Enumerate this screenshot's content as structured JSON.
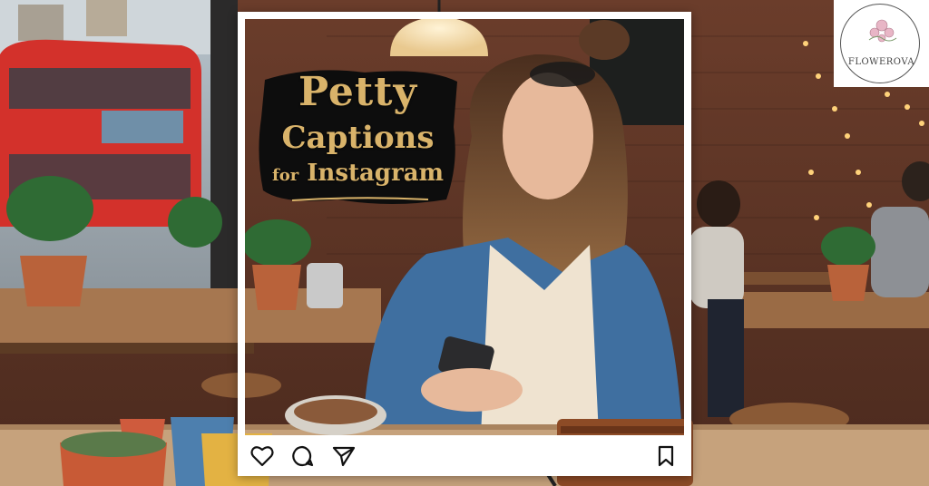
{
  "headline": {
    "line1": "Petty",
    "line2": "Captions",
    "line3_for": "for",
    "line3_rest": "Instagram"
  },
  "logo": {
    "text": "FLOWEROVA"
  },
  "post_actions": {
    "like_icon": "heart-icon",
    "comment_icon": "comment-icon",
    "share_icon": "send-icon",
    "save_icon": "bookmark-icon"
  },
  "colors": {
    "title_gold": "#d9b36a",
    "frame": "#ffffff",
    "bus_red": "#d3312b"
  }
}
